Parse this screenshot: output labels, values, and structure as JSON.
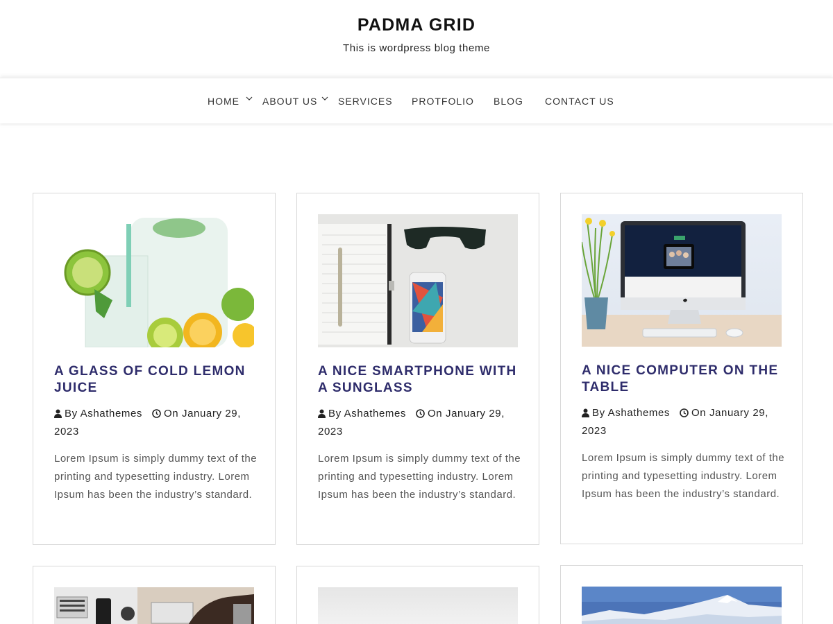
{
  "site": {
    "title": "PADMA GRID",
    "tagline": "This is wordpress blog theme"
  },
  "nav": {
    "items": [
      {
        "label": "HOME",
        "has_submenu": true
      },
      {
        "label": "ABOUT US",
        "has_submenu": true
      },
      {
        "label": "SERVICES",
        "has_submenu": false
      },
      {
        "label": "PROTFOLIO",
        "has_submenu": false
      },
      {
        "label": "BLOG",
        "has_submenu": false
      },
      {
        "label": "CONTACT US",
        "has_submenu": false
      }
    ]
  },
  "posts": [
    {
      "title": "A GLASS OF COLD LEMON JUICE",
      "author": "By Ashathemes",
      "date": "On January 29, 2023",
      "excerpt": "Lorem Ipsum is simply dummy text of the printing and typesetting industry. Lorem Ipsum has been the industry’s standard.",
      "image": "lemon-juice-image"
    },
    {
      "title": "A NICE SMARTPHONE WITH A SUNGLASS",
      "author": "By Ashathemes",
      "date": "On January 29, 2023",
      "excerpt": "Lorem Ipsum is simply dummy text of the printing and typesetting industry. Lorem Ipsum has been the industry’s standard.",
      "image": "smartphone-sunglass-image"
    },
    {
      "title": "A NICE COMPUTER ON THE TABLE",
      "author": "By Ashathemes",
      "date": "On January 29, 2023",
      "excerpt": "Lorem Ipsum is simply dummy text of the printing and typesetting industry. Lorem Ipsum has been the industry’s standard.",
      "image": "computer-table-image"
    },
    {
      "image": "workspace-desk-image"
    },
    {
      "image": "light-gray-image"
    },
    {
      "image": "snowy-mountain-image"
    }
  ],
  "colors": {
    "post_title": "#2e2c6b",
    "text": "#222222",
    "excerpt": "#555555",
    "card_border": "#d8d8d8"
  }
}
